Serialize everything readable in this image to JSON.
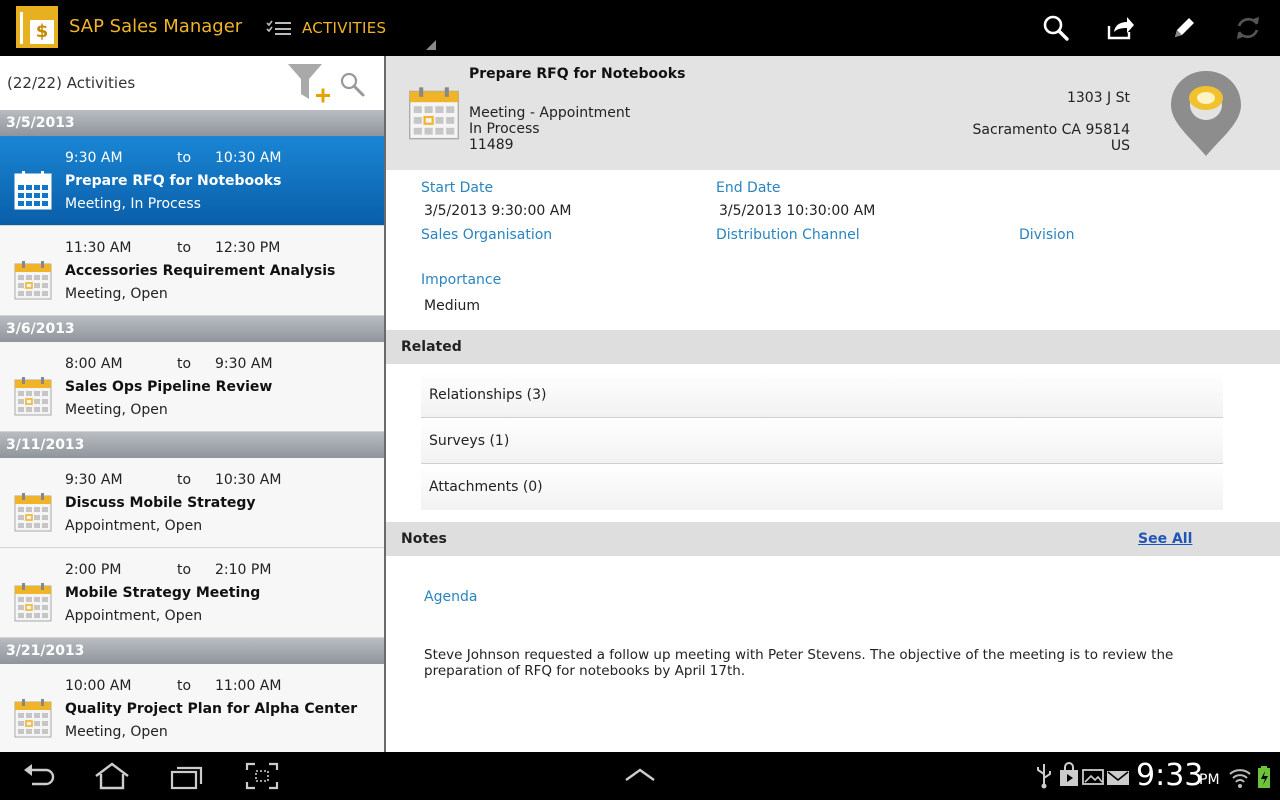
{
  "app": {
    "title": "SAP Sales Manager",
    "section": "ACTIVITIES"
  },
  "list": {
    "count_label": "(22/22) Activities",
    "groups": [
      {
        "date": "3/5/2013",
        "items": [
          {
            "start": "9:30 AM",
            "to": "to",
            "end": "10:30 AM",
            "title": "Prepare RFQ for Notebooks",
            "subtitle": "Meeting, In Process",
            "selected": true
          },
          {
            "start": "11:30 AM",
            "to": "to",
            "end": "12:30 PM",
            "title": "Accessories Requirement Analysis",
            "subtitle": "Meeting, Open"
          }
        ]
      },
      {
        "date": "3/6/2013",
        "items": [
          {
            "start": "8:00 AM",
            "to": "to",
            "end": "9:30 AM",
            "title": "Sales Ops Pipeline Review",
            "subtitle": "Meeting, Open"
          }
        ]
      },
      {
        "date": "3/11/2013",
        "items": [
          {
            "start": "9:30 AM",
            "to": "to",
            "end": "10:30 AM",
            "title": "Discuss Mobile Strategy",
            "subtitle": "Appointment, Open"
          },
          {
            "start": "2:00 PM",
            "to": "to",
            "end": "2:10 PM",
            "title": "Mobile Strategy Meeting",
            "subtitle": "Appointment, Open"
          }
        ]
      },
      {
        "date": "3/21/2013",
        "items": [
          {
            "start": "10:00 AM",
            "to": "to",
            "end": "11:00 AM",
            "title": "Quality Project Plan for Alpha Center",
            "subtitle": "Meeting, Open"
          }
        ]
      }
    ]
  },
  "detail": {
    "title": "Prepare RFQ for Notebooks",
    "type": "Meeting - Appointment",
    "status": "In Process",
    "id": "11489",
    "address": {
      "street": "1303 J St",
      "city": "Sacramento CA 95814",
      "country": "US"
    },
    "fields": {
      "start_date_label": "Start Date",
      "start_date": "3/5/2013 9:30:00 AM",
      "end_date_label": "End Date",
      "end_date": "3/5/2013 10:30:00 AM",
      "sales_org_label": "Sales Organisation",
      "dist_channel_label": "Distribution Channel",
      "division_label": "Division",
      "importance_label": "Importance",
      "importance": "Medium"
    },
    "related": {
      "header": "Related",
      "items": [
        "Relationships (3)",
        "Surveys (1)",
        "Attachments (0)"
      ]
    },
    "notes": {
      "header": "Notes",
      "see_all": "See All",
      "title": "Agenda",
      "body": "Steve Johnson requested a follow up meeting with Peter Stevens. The objective of the meeting is to review the preparation of RFQ for notebooks by April 17th."
    }
  },
  "system": {
    "time": "9:33",
    "ampm": "PM"
  },
  "colors": {
    "accent": "#f0b429",
    "selected": "#0f6fbf",
    "link": "#2a84c0"
  }
}
